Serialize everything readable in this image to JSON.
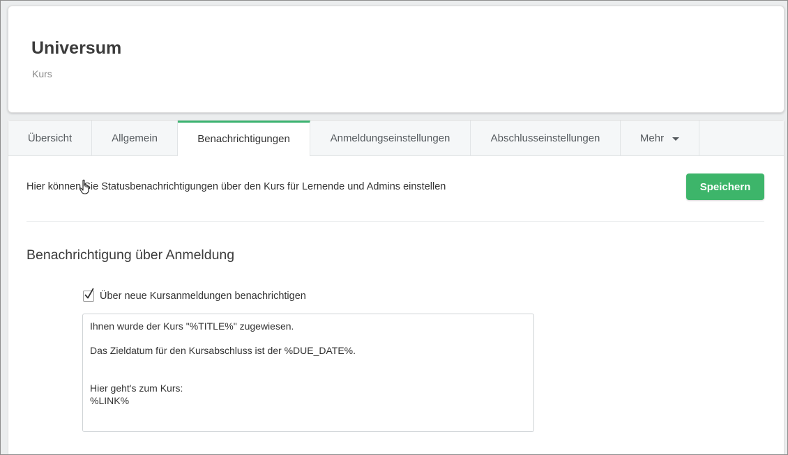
{
  "header": {
    "title": "Universum",
    "subtitle": "Kurs"
  },
  "tabs": [
    {
      "label": "Übersicht",
      "active": false
    },
    {
      "label": "Allgemein",
      "active": false
    },
    {
      "label": "Benachrichtigungen",
      "active": true
    },
    {
      "label": "Anmeldungseinstellungen",
      "active": false
    },
    {
      "label": "Abschlusseinstellungen",
      "active": false
    },
    {
      "label": "Mehr",
      "active": false,
      "icon": "caret-down-icon"
    }
  ],
  "main": {
    "intro": "Hier können Sie Statusbenachrichtigungen über den Kurs für Lernende und Admins einstellen",
    "save_label": "Speichern",
    "section_heading": "Benachrichtigung über Anmeldung",
    "checkbox": {
      "label": "Über neue Kursanmeldungen benachrichtigen",
      "checked": true
    },
    "message": {
      "line1": "Ihnen wurde der Kurs \"%TITLE%\" zugewiesen.",
      "line2": "Das Zieldatum für den Kursabschluss ist der %DUE_DATE%.",
      "line3": "Hier geht's zum Kurs:",
      "line4": "%LINK%"
    }
  },
  "colors": {
    "accent": "#3cb371",
    "save_button": "#3db56a",
    "background": "#ebedee"
  }
}
